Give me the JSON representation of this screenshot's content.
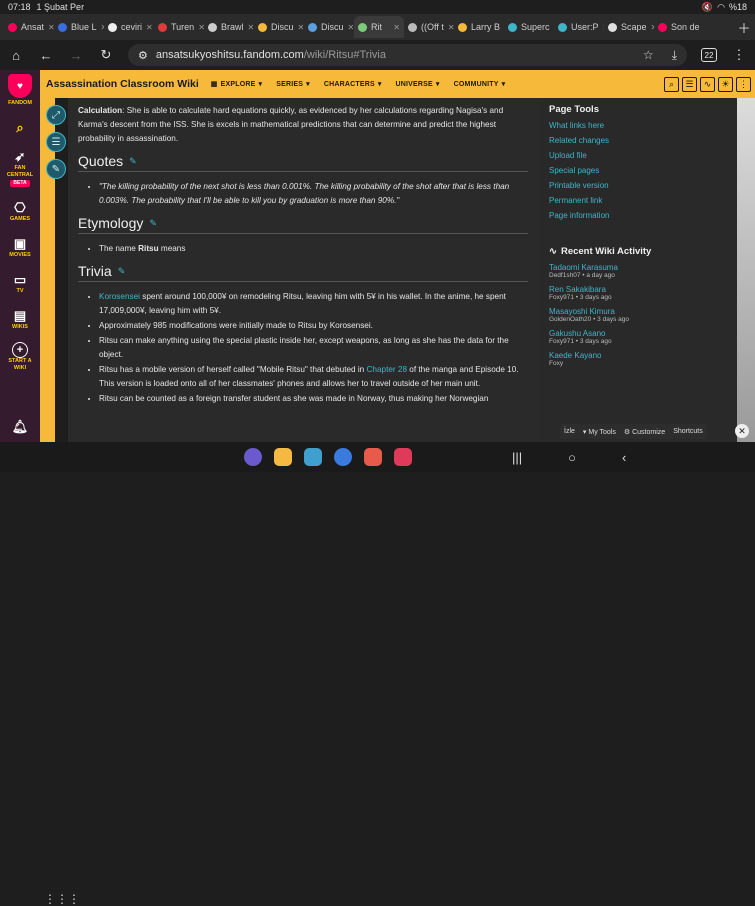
{
  "status": {
    "time": "07:18",
    "date": "1 Şubat Per",
    "battery": "%18"
  },
  "tabs": [
    {
      "label": "Ansat",
      "color": "#fa005a"
    },
    {
      "label": "Blue L",
      "color": "#3a6de0"
    },
    {
      "label": "ceviri",
      "color": "#eeeeee"
    },
    {
      "label": "Turen",
      "color": "#e03a3a"
    },
    {
      "label": "Brawl",
      "color": "#cccccc"
    },
    {
      "label": "Discu",
      "color": "#f7b93a"
    },
    {
      "label": "Discu",
      "color": "#5aa0e0"
    },
    {
      "label": "Rit",
      "color": "#7acc7a",
      "active": true
    },
    {
      "label": "((Off t",
      "color": "#bbbbbb"
    },
    {
      "label": "Larry B",
      "color": "#f7b93a"
    },
    {
      "label": "Superc",
      "color": "#3fb6c8"
    },
    {
      "label": "User:P",
      "color": "#3fb6c8"
    },
    {
      "label": "Scape",
      "color": "#e0e0e0"
    },
    {
      "label": "Son de",
      "color": "#fa005a"
    }
  ],
  "url": {
    "domain": "ansatsukyoshitsu.fandom.com",
    "path": "/wiki/Ritsu#Trivia",
    "tab_count": "22"
  },
  "rail": [
    {
      "label": "FANDOM",
      "icon": "fandom-logo"
    },
    {
      "label": "",
      "icon": "search-icon"
    },
    {
      "label": "FAN CENTRAL",
      "icon": "rocket-icon",
      "badge": "BETA"
    },
    {
      "label": "GAMES",
      "icon": "gamepad-icon"
    },
    {
      "label": "MOVIES",
      "icon": "clapper-icon"
    },
    {
      "label": "TV",
      "icon": "tv-icon"
    },
    {
      "label": "WIKIS",
      "icon": "book-icon"
    },
    {
      "label": "START A WIKI",
      "icon": "plus-icon"
    }
  ],
  "wikibar": {
    "name": "Assassination Classroom Wiki",
    "nav": [
      "EXPLORE",
      "SERIES",
      "CHARACTERS",
      "UNIVERSE",
      "COMMUNITY"
    ]
  },
  "article": {
    "calc_label": "Calculation",
    "calc_text": ": She is able to calculate hard equations quickly, as evidenced by her calculations regarding Nagisa's and Karma's descent from the ISS. She is excels in mathematical predictions that can determine and predict the highest probability in assassination.",
    "quotes_heading": "Quotes",
    "quote": "\"The killing probability of the next shot is less than 0.001%. The killing probability of the shot after that is less than 0.003%. The probability that I'll be able to kill you by graduation is more than 90%.\"",
    "etym_heading": "Etymology",
    "etym_pre": "The name ",
    "etym_bold": "Ritsu",
    "etym_post": " means",
    "trivia_heading": "Trivia",
    "t1_link": "Korosensei",
    "t1_text": " spent around 100,000¥ on remodeling Ritsu, leaving him with 5¥ in his wallet. In the anime, he spent 17,009,000¥, leaving him with 5¥.",
    "t2": "Approximately 985 modifications were initially made to Ritsu by Korosensei.",
    "t3": "Ritsu can make anything using the special plastic inside her, except weapons, as long as she has the data for the object.",
    "t4_a": "Ritsu has a mobile version of herself called \"Mobile Ritsu\" that debuted in ",
    "t4_link": "Chapter 28",
    "t4_b": " of the manga and Episode 10. This version is loaded onto all of her classmates' phones and allows her to travel outside of her main unit.",
    "t5": "Ritsu can be counted as a foreign transfer student as she was made in Norway, thus making her Norwegian"
  },
  "page_tools": {
    "title": "Page Tools",
    "links": [
      "What links here",
      "Related changes",
      "Upload file",
      "Special pages",
      "Printable version",
      "Permanent link",
      "Page information"
    ]
  },
  "activity": {
    "title": "Recent Wiki Activity",
    "items": [
      {
        "page": "Tadaomi Karasuma",
        "meta": "Dedf1sh07 • a day ago"
      },
      {
        "page": "Ren Sakakibara",
        "meta": "Foxy971 • 3 days ago"
      },
      {
        "page": "Masayoshi Kimura",
        "meta": "GoldenOath20 • 3 days ago"
      },
      {
        "page": "Gakushu Asano",
        "meta": "Foxy971 • 3 days ago"
      },
      {
        "page": "Kaede Kayano",
        "meta": "Foxy"
      }
    ]
  },
  "bottombar": {
    "izle": "İzle",
    "mytools": "My Tools",
    "customize": "Customize",
    "shortcuts": "Shortcuts"
  }
}
